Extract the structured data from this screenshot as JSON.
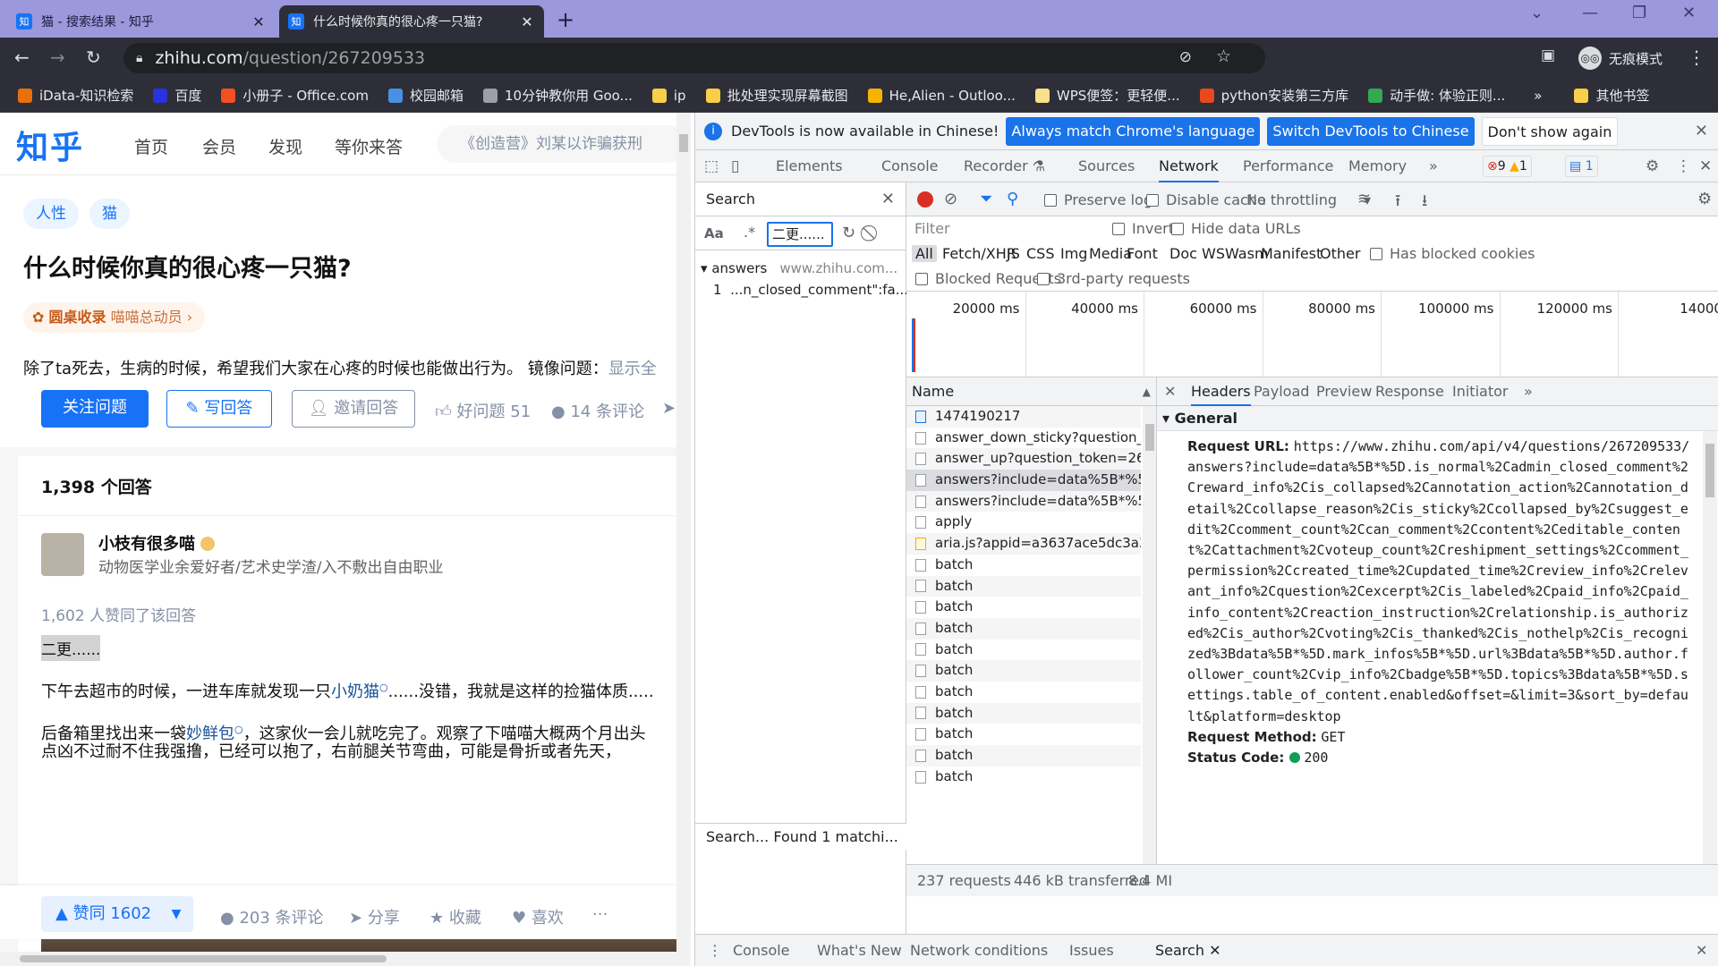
{
  "browser": {
    "tabs": [
      {
        "title": "猫 - 搜索结果 - 知乎",
        "favicon": "知",
        "active": false
      },
      {
        "title": "什么时候你真的很心疼一只猫?",
        "favicon": "知",
        "active": true
      }
    ],
    "url_host": "zhihu.com",
    "url_path": "/question/267209533",
    "profile_label": "无痕模式",
    "bookmarks": [
      {
        "label": "iData-知识检索",
        "color": "#e8710a"
      },
      {
        "label": "百度",
        "color": "#2932e1"
      },
      {
        "label": "小册子 - Office.com",
        "color": "#f25022"
      },
      {
        "label": "校园邮箱",
        "color": "#4a90e2"
      },
      {
        "label": "10分钟教你用 Goo...",
        "color": "#9aa0a6"
      },
      {
        "label": "ip",
        "color": "#f9cf4a"
      },
      {
        "label": "批处理实现屏幕截图",
        "color": "#f9cf4a"
      },
      {
        "label": "He,Alien - Outloo...",
        "color": "#f5b400"
      },
      {
        "label": "WPS便签：更轻便...",
        "color": "#f9e08a"
      },
      {
        "label": "python安装第三方库",
        "color": "#e8491d"
      },
      {
        "label": "动手做: 体验正则...",
        "color": "#34a853"
      }
    ],
    "other_bookmarks": "其他书签"
  },
  "zhihu": {
    "logo": "知乎",
    "nav": [
      "首页",
      "会员",
      "发现",
      "等你来答"
    ],
    "search_placeholder": "《创造营》刘某以诈骗获刑",
    "topics": [
      "人性",
      "猫"
    ],
    "question_title": "什么时候你真的很心疼一只猫?",
    "roundtable_bold": "圆桌收录",
    "roundtable_name": "喵喵总动员",
    "question_desc": "除了ta死去，生病的时候，希望我们大家在心疼的时候也能做出行为。 镜像问题：",
    "question_desc_more": "显示全",
    "follow_btn": "关注问题",
    "write_btn": "写回答",
    "invite_btn": "邀请回答",
    "good_question": "好问题 51",
    "comments": "14 条评论",
    "answer_count": "1,398 个回答",
    "author_name": "小枝有很多喵",
    "author_bio": "动物医学业余爱好者/艺术史学渣/入不敷出自由职业",
    "upvote_info": "1,602 人赞同了该回答",
    "highlight": "二更......",
    "para1_a": "下午去超市的时候，一进车库就发现一只",
    "para1_link": "小奶猫",
    "para1_b": "......没错，我就是这样的捡猫体质.....",
    "para2_a": "后备箱里找出来一袋",
    "para2_link": "妙鲜包",
    "para2_b": "，这家伙一会儿就吃完了。观察了下喵喵大概两个月出头",
    "para3": "点凶不过耐不住我强撸，已经可以抱了，右前腿关节弯曲，可能是骨折或者先天，",
    "vote_label": "▲ 赞同 1602",
    "act_comments": "203 条评论",
    "act_share": "分享",
    "act_collect": "收藏",
    "act_like": "喜欢",
    "act_more": "···"
  },
  "devtools": {
    "info_text": "DevTools is now available in Chinese!",
    "info_btn1": "Always match Chrome's language",
    "info_btn2": "Switch DevTools to Chinese",
    "info_btn3": "Don't show again",
    "tabs": [
      "Elements",
      "Console",
      "Recorder",
      "Sources",
      "Network",
      "Performance",
      "Memory"
    ],
    "errors": "9",
    "warnings": "1",
    "messages": "1",
    "search": {
      "title": "Search",
      "query": "二更......",
      "result_file": "answers",
      "result_url": "www.zhihu.com...",
      "result_line_no": "1",
      "result_line": "...n_closed_comment\":fa...",
      "footer": "Search... Found 1 matchi..."
    },
    "network": {
      "preserve_log": "Preserve log",
      "disable_cache": "Disable cache",
      "throttling": "No throttling",
      "filter_placeholder": "Filter",
      "invert": "Invert",
      "hide_data_urls": "Hide data URLs",
      "types": [
        "All",
        "Fetch/XHR",
        "JS",
        "CSS",
        "Img",
        "Media",
        "Font",
        "Doc",
        "WS",
        "Wasm",
        "Manifest",
        "Other"
      ],
      "has_blocked_cookies": "Has blocked cookies",
      "blocked_requests": "Blocked Requests",
      "third_party": "3rd-party requests",
      "timeline_labels": [
        "20000 ms",
        "40000 ms",
        "60000 ms",
        "80000 ms",
        "100000 ms",
        "120000 ms",
        "140000"
      ],
      "name_header": "Name",
      "requests": [
        {
          "name": "1474190217",
          "kind": "doc"
        },
        {
          "name": "answer_down_sticky?question_token=2",
          "kind": "xhr"
        },
        {
          "name": "answer_up?question_token=267209533",
          "kind": "xhr"
        },
        {
          "name": "answers?include=data%5B*%5D.is_nor...",
          "kind": "xhr"
        },
        {
          "name": "answers?include=data%5B*%5D.is_nor...",
          "kind": "xhr"
        },
        {
          "name": "apply",
          "kind": "xhr"
        },
        {
          "name": "aria.js?appid=a3637ace5dc3a347f6863...",
          "kind": "js"
        },
        {
          "name": "batch",
          "kind": "xhr"
        },
        {
          "name": "batch",
          "kind": "xhr"
        },
        {
          "name": "batch",
          "kind": "xhr"
        },
        {
          "name": "batch",
          "kind": "xhr"
        },
        {
          "name": "batch",
          "kind": "xhr"
        },
        {
          "name": "batch",
          "kind": "xhr"
        },
        {
          "name": "batch",
          "kind": "xhr"
        },
        {
          "name": "batch",
          "kind": "xhr"
        },
        {
          "name": "batch",
          "kind": "xhr"
        },
        {
          "name": "batch",
          "kind": "xhr"
        },
        {
          "name": "batch",
          "kind": "xhr"
        }
      ],
      "detail_tabs": [
        "Headers",
        "Payload",
        "Preview",
        "Response",
        "Initiator"
      ],
      "general": "General",
      "request_url_label": "Request URL:",
      "request_url": "https://www.zhihu.com/api/v4/questions/267209533/answers?include=data%5B*%5D.is_normal%2Cadmin_closed_comment%2Creward_info%2Cis_collapsed%2Cannotation_action%2Cannotation_detail%2Ccollapse_reason%2Cis_sticky%2Ccollapsed_by%2Csuggest_edit%2Ccomment_count%2Ccan_comment%2Ccontent%2Ceditable_content%2Cattachment%2Cvoteup_count%2Creshipment_settings%2Ccomment_permission%2Ccreated_time%2Cupdated_time%2Creview_info%2Crelevant_info%2Cquestion%2Cexcerpt%2Cis_labeled%2Cpaid_info%2Cpaid_info_content%2Creaction_instruction%2Crelationship.is_authorized%2Cis_author%2Cvoting%2Cis_thanked%2Cis_nothelp%2Cis_recognized%3Bdata%5B*%5D.mark_infos%5B*%5D.url%3Bdata%5B*%5D.author.follower_count%2Cvip_info%2Cbadge%5B*%5D.topics%3Bdata%5B*%5D.settings.table_of_content.enabled&offset=&limit=3&sort_by=default&platform=desktop",
      "method_label": "Request Method:",
      "method": "GET",
      "status_label": "Status Code:",
      "status": "200",
      "summary_requests": "237 requests",
      "summary_transferred": "446 kB transferred",
      "summary_resources": "8.4 MI"
    },
    "drawer": [
      "Console",
      "What's New",
      "Network conditions",
      "Issues",
      "Search"
    ]
  }
}
